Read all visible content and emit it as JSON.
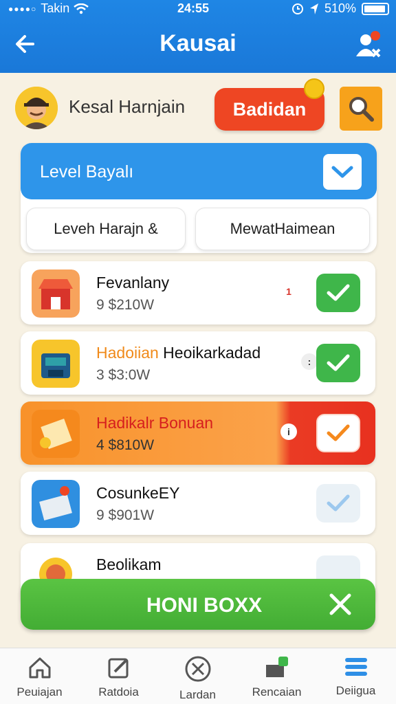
{
  "status": {
    "carrier": "Takin",
    "time": "24:55",
    "battery": "510%"
  },
  "header": {
    "title": "Kausai"
  },
  "profile": {
    "name": "Kesal Harnjain",
    "badge_label": "Badidan"
  },
  "level": {
    "title": "Level Bayalı",
    "tabs": [
      "Leveh Harajn &",
      "MewatHaimean"
    ]
  },
  "rewards": [
    {
      "name": "Fevanlany",
      "price": "9 $210W",
      "mark": "1",
      "checked": true
    },
    {
      "name_accent": "Hadoiian",
      "name_rest": " Heoikarkadad",
      "price": "3 $3:0W",
      "mark": ":",
      "checked": true
    },
    {
      "name": "Hadikalr Bonuan",
      "price": "4 $810W",
      "mark": "i",
      "checked": true
    },
    {
      "name": "CosunkeEY",
      "price": "9 $901W",
      "checked": false
    },
    {
      "name": "Beolikam",
      "checked": false
    }
  ],
  "action_bar": {
    "label": "HONI BOXX"
  },
  "bottom_nav": [
    "Peuiajan",
    "Ratdoia",
    "Lardan",
    "Rencaian",
    "Deiigua"
  ],
  "colors": {
    "primary": "#1f86e5",
    "danger": "#ee4623",
    "success": "#3fb64a",
    "accent": "#f7a21b"
  }
}
